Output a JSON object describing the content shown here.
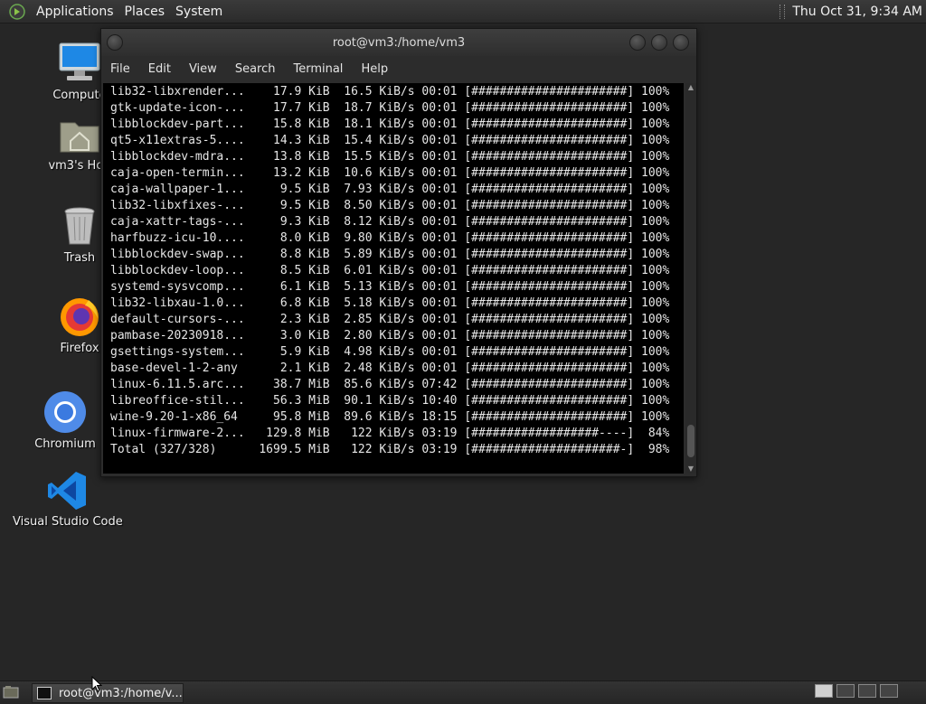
{
  "top_panel": {
    "menus": [
      "Applications",
      "Places",
      "System"
    ],
    "clock": "Thu Oct 31,  9:34 AM"
  },
  "desktop_icons": [
    {
      "label": "Compute",
      "icon": "computer-icon"
    },
    {
      "label": "vm3's Hon",
      "icon": "home-folder-icon"
    },
    {
      "label": "Trash",
      "icon": "trash-icon"
    },
    {
      "label": "Firefox",
      "icon": "firefox-icon"
    },
    {
      "label": "Chromium",
      "icon": "chromium-icon"
    },
    {
      "label": "Visual Studio Code",
      "icon": "vscode-icon"
    }
  ],
  "terminal": {
    "title": "root@vm3:/home/vm3",
    "menu": [
      "File",
      "Edit",
      "View",
      "Search",
      "Terminal",
      "Help"
    ],
    "lines": [
      "lib32-libxrender...    17.9 KiB  16.5 KiB/s 00:01 [######################] 100%",
      "gtk-update-icon-...    17.7 KiB  18.7 KiB/s 00:01 [######################] 100%",
      "libblockdev-part...    15.8 KiB  18.1 KiB/s 00:01 [######################] 100%",
      "qt5-x11extras-5....    14.3 KiB  15.4 KiB/s 00:01 [######################] 100%",
      "libblockdev-mdra...    13.8 KiB  15.5 KiB/s 00:01 [######################] 100%",
      "caja-open-termin...    13.2 KiB  10.6 KiB/s 00:01 [######################] 100%",
      "caja-wallpaper-1...     9.5 KiB  7.93 KiB/s 00:01 [######################] 100%",
      "lib32-libxfixes-...     9.5 KiB  8.50 KiB/s 00:01 [######################] 100%",
      "caja-xattr-tags-...     9.3 KiB  8.12 KiB/s 00:01 [######################] 100%",
      "harfbuzz-icu-10....     8.0 KiB  9.80 KiB/s 00:01 [######################] 100%",
      "libblockdev-swap...     8.8 KiB  5.89 KiB/s 00:01 [######################] 100%",
      "libblockdev-loop...     8.5 KiB  6.01 KiB/s 00:01 [######################] 100%",
      "systemd-sysvcomp...     6.1 KiB  5.13 KiB/s 00:01 [######################] 100%",
      "lib32-libxau-1.0...     6.8 KiB  5.18 KiB/s 00:01 [######################] 100%",
      "default-cursors-...     2.3 KiB  2.85 KiB/s 00:01 [######################] 100%",
      "pambase-20230918...     3.0 KiB  2.80 KiB/s 00:01 [######################] 100%",
      "gsettings-system...     5.9 KiB  4.98 KiB/s 00:01 [######################] 100%",
      "base-devel-1-2-any      2.1 KiB  2.48 KiB/s 00:01 [######################] 100%",
      "linux-6.11.5.arc...    38.7 MiB  85.6 KiB/s 07:42 [######################] 100%",
      "libreoffice-stil...    56.3 MiB  90.1 KiB/s 10:40 [######################] 100%",
      "wine-9.20-1-x86_64     95.8 MiB  89.6 KiB/s 18:15 [######################] 100%",
      "linux-firmware-2...   129.8 MiB   122 KiB/s 03:19 [##################----]  84%",
      "Total (327/328)      1699.5 MiB   122 KiB/s 03:19 [#####################-]  98%"
    ]
  },
  "taskbar": {
    "task_label": "root@vm3:/home/v..."
  }
}
